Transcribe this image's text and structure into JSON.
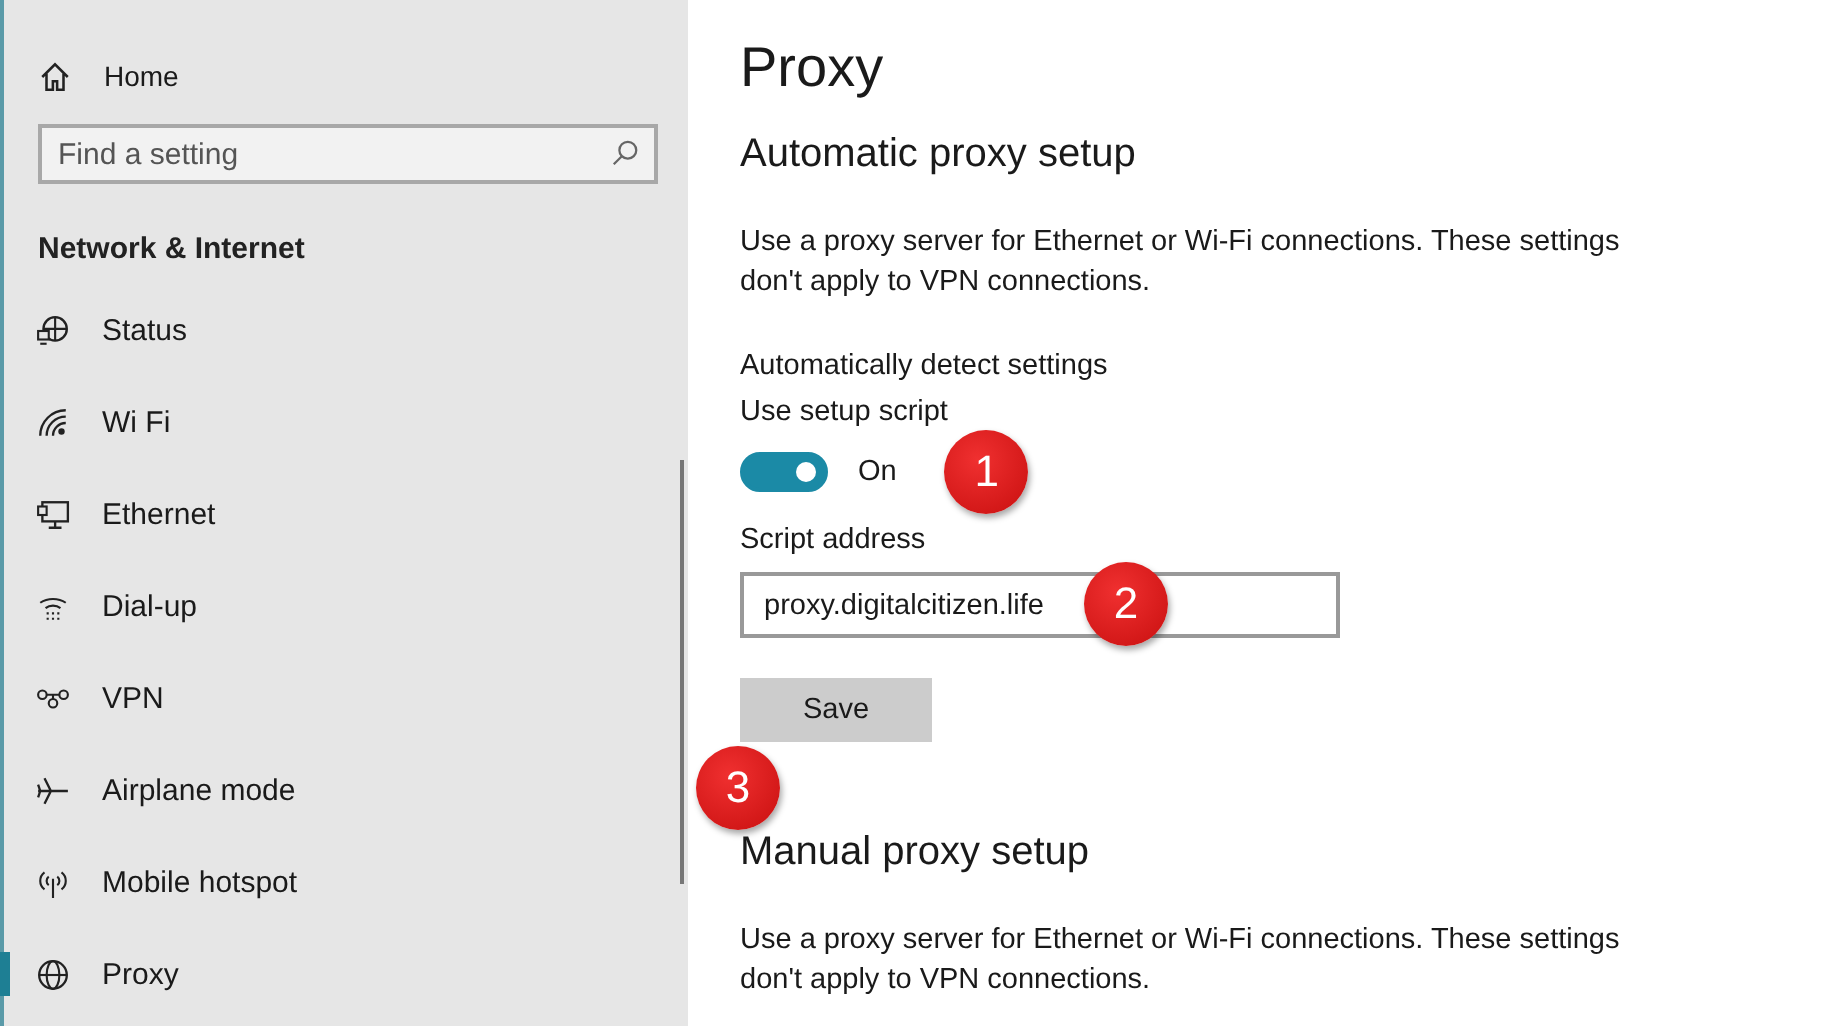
{
  "sidebar": {
    "home": "Home",
    "search": {
      "placeholder": "Find a setting"
    },
    "heading": "Network & Internet",
    "items": [
      {
        "label": "Status",
        "kind": "status",
        "selected": false
      },
      {
        "label": "Wi Fi",
        "kind": "wifi",
        "selected": false
      },
      {
        "label": "Ethernet",
        "kind": "ethernet",
        "selected": false
      },
      {
        "label": "Dial-up",
        "kind": "dialup",
        "selected": false
      },
      {
        "label": "VPN",
        "kind": "vpn",
        "selected": false
      },
      {
        "label": "Airplane mode",
        "kind": "airplane",
        "selected": false
      },
      {
        "label": "Mobile hotspot",
        "kind": "hotspot",
        "selected": false
      },
      {
        "label": "Proxy",
        "kind": "globe",
        "selected": true
      }
    ]
  },
  "main": {
    "title": "Proxy",
    "automatic": {
      "heading": "Automatic proxy setup",
      "description": "Use a proxy server for Ethernet or Wi-Fi connections. These settings don't apply to VPN connections.",
      "detect_label": "Automatically detect settings",
      "script_label": "Use setup script",
      "script_toggle": {
        "on": true,
        "state_text": "On"
      },
      "address_label": "Script address",
      "address_value": "proxy.digitalcitizen.life",
      "save": "Save"
    },
    "manual": {
      "heading": "Manual proxy setup",
      "description": "Use a proxy server for Ethernet or Wi-Fi connections. These settings don't apply to VPN connections."
    }
  },
  "callouts": [
    "1",
    "2",
    "3"
  ]
}
